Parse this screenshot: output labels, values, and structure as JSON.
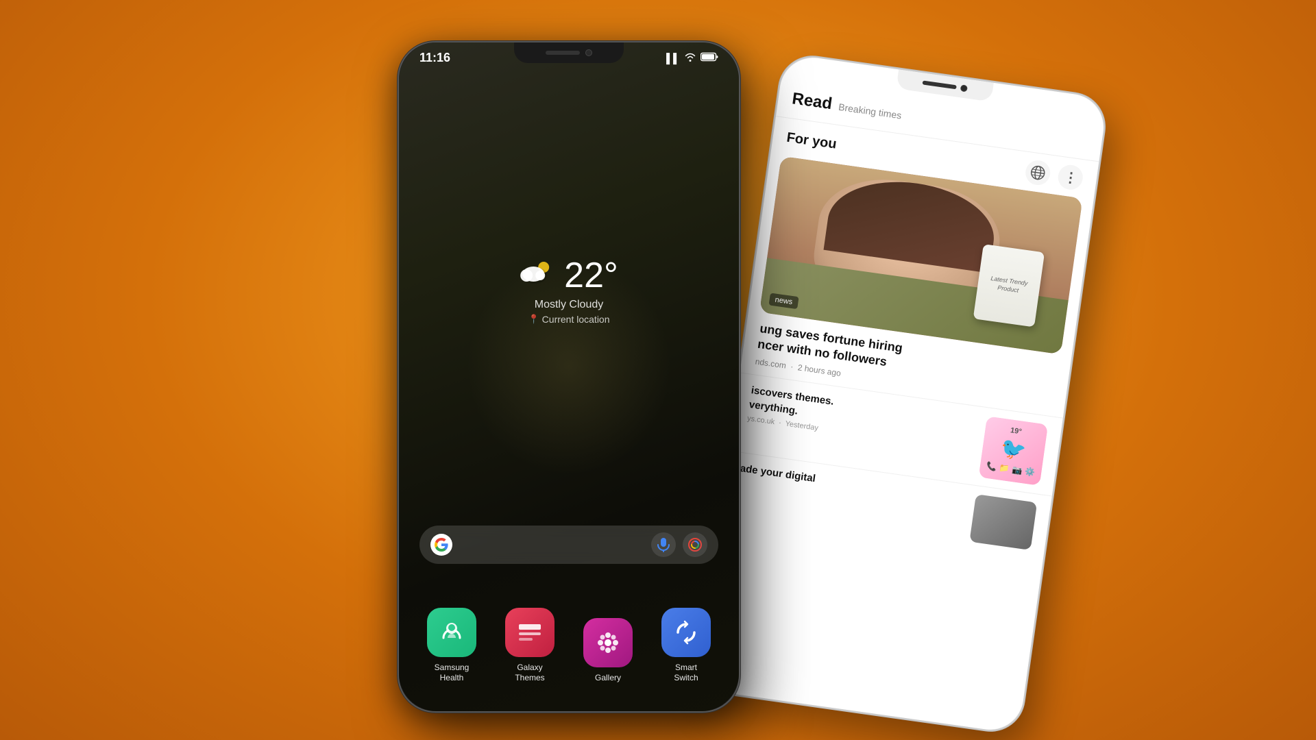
{
  "background": {
    "gradient": "radial orange"
  },
  "phone_front": {
    "status_bar": {
      "time": "11:16",
      "signal_icon": "signal",
      "wifi_icon": "wifi",
      "battery_icon": "battery"
    },
    "weather": {
      "icon": "☁️🌤",
      "temperature": "22°",
      "description": "Mostly Cloudy",
      "location_label": "Current location",
      "location_icon": "📍"
    },
    "search_bar": {
      "google_letter": "G",
      "mic_icon": "🎤",
      "lens_icon": "📷"
    },
    "apps": [
      {
        "id": "samsung-health",
        "name": "Samsung\nHealth",
        "icon_emoji": "🧘",
        "icon_style": "samsung-health"
      },
      {
        "id": "galaxy-themes",
        "name": "Galaxy\nThemes",
        "icon_emoji": "⚙️",
        "icon_style": "galaxy-themes"
      },
      {
        "id": "gallery",
        "name": "Gallery",
        "icon_emoji": "❀",
        "icon_style": "gallery"
      },
      {
        "id": "smart-switch",
        "name": "Smart\nSwitch",
        "icon_emoji": "↔",
        "icon_style": "smart-switch"
      }
    ]
  },
  "phone_back": {
    "app": {
      "name": "Read",
      "subtitle": "Breaking times",
      "section": "For you"
    },
    "articles": [
      {
        "id": "article-1",
        "tag": "news",
        "headline": "ung saves fortune hiring\nncer with no followers",
        "meta_source": "nds.com",
        "meta_time": "2 hours ago",
        "product_label": "Latest Trendy Product"
      },
      {
        "id": "article-2",
        "headline": "iscovers themes.\nverything.",
        "meta_source": "ys.co.uk",
        "meta_time": "Yesterday"
      },
      {
        "id": "article-3",
        "headline": "ade your digital",
        "meta_source": "",
        "meta_time": ""
      }
    ],
    "icons": {
      "globe": "🌐",
      "more": "⋮"
    }
  }
}
